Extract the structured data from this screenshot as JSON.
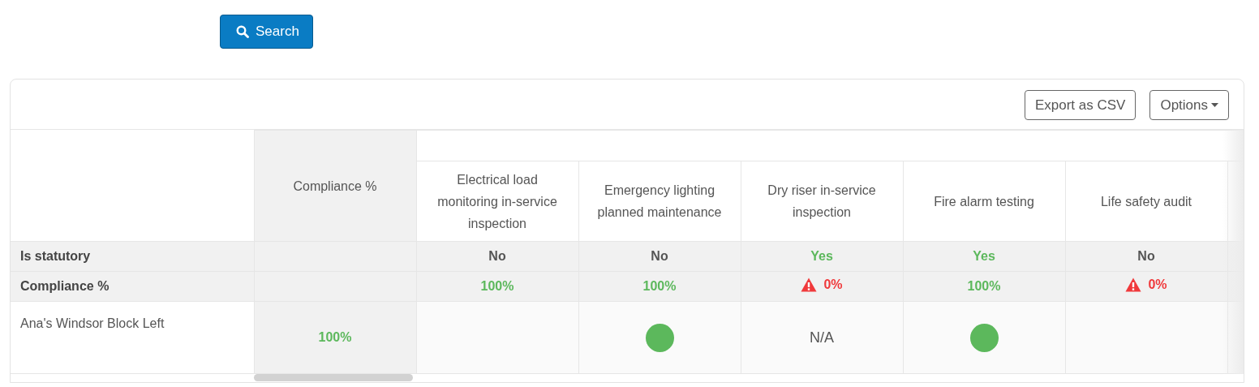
{
  "search_button": {
    "label": "Search"
  },
  "toolbar": {
    "buttons": [
      {
        "label": "Export as CSV",
        "kind": "plain"
      },
      {
        "label": "Options",
        "kind": "dropdown"
      }
    ]
  },
  "table": {
    "compliance_header": "Compliance %",
    "columns": [
      "Electrical load monitoring in-service inspection",
      "Emergency lighting planned maintenance",
      "Dry riser in-service inspection",
      "Fire alarm testing",
      "Life safety audit"
    ],
    "statutory_row": {
      "label": "Is statutory",
      "values": [
        {
          "text": "No",
          "positive": false
        },
        {
          "text": "No",
          "positive": false
        },
        {
          "text": "Yes",
          "positive": true
        },
        {
          "text": "Yes",
          "positive": true
        },
        {
          "text": "No",
          "positive": false
        }
      ]
    },
    "compliance_row": {
      "label": "Compliance %",
      "values": [
        {
          "text": "100%",
          "warning": false
        },
        {
          "text": "100%",
          "warning": false
        },
        {
          "text": "0%",
          "warning": true
        },
        {
          "text": "100%",
          "warning": false
        },
        {
          "text": "0%",
          "warning": true
        }
      ]
    },
    "rows": [
      {
        "name": "Ana's Windsor Block Left",
        "compliance": "100%",
        "cells": [
          {
            "kind": "empty"
          },
          {
            "kind": "dot",
            "color": "#5cb85c"
          },
          {
            "kind": "text",
            "text": "N/A"
          },
          {
            "kind": "dot",
            "color": "#5cb85c"
          },
          {
            "kind": "empty"
          }
        ]
      }
    ]
  }
}
